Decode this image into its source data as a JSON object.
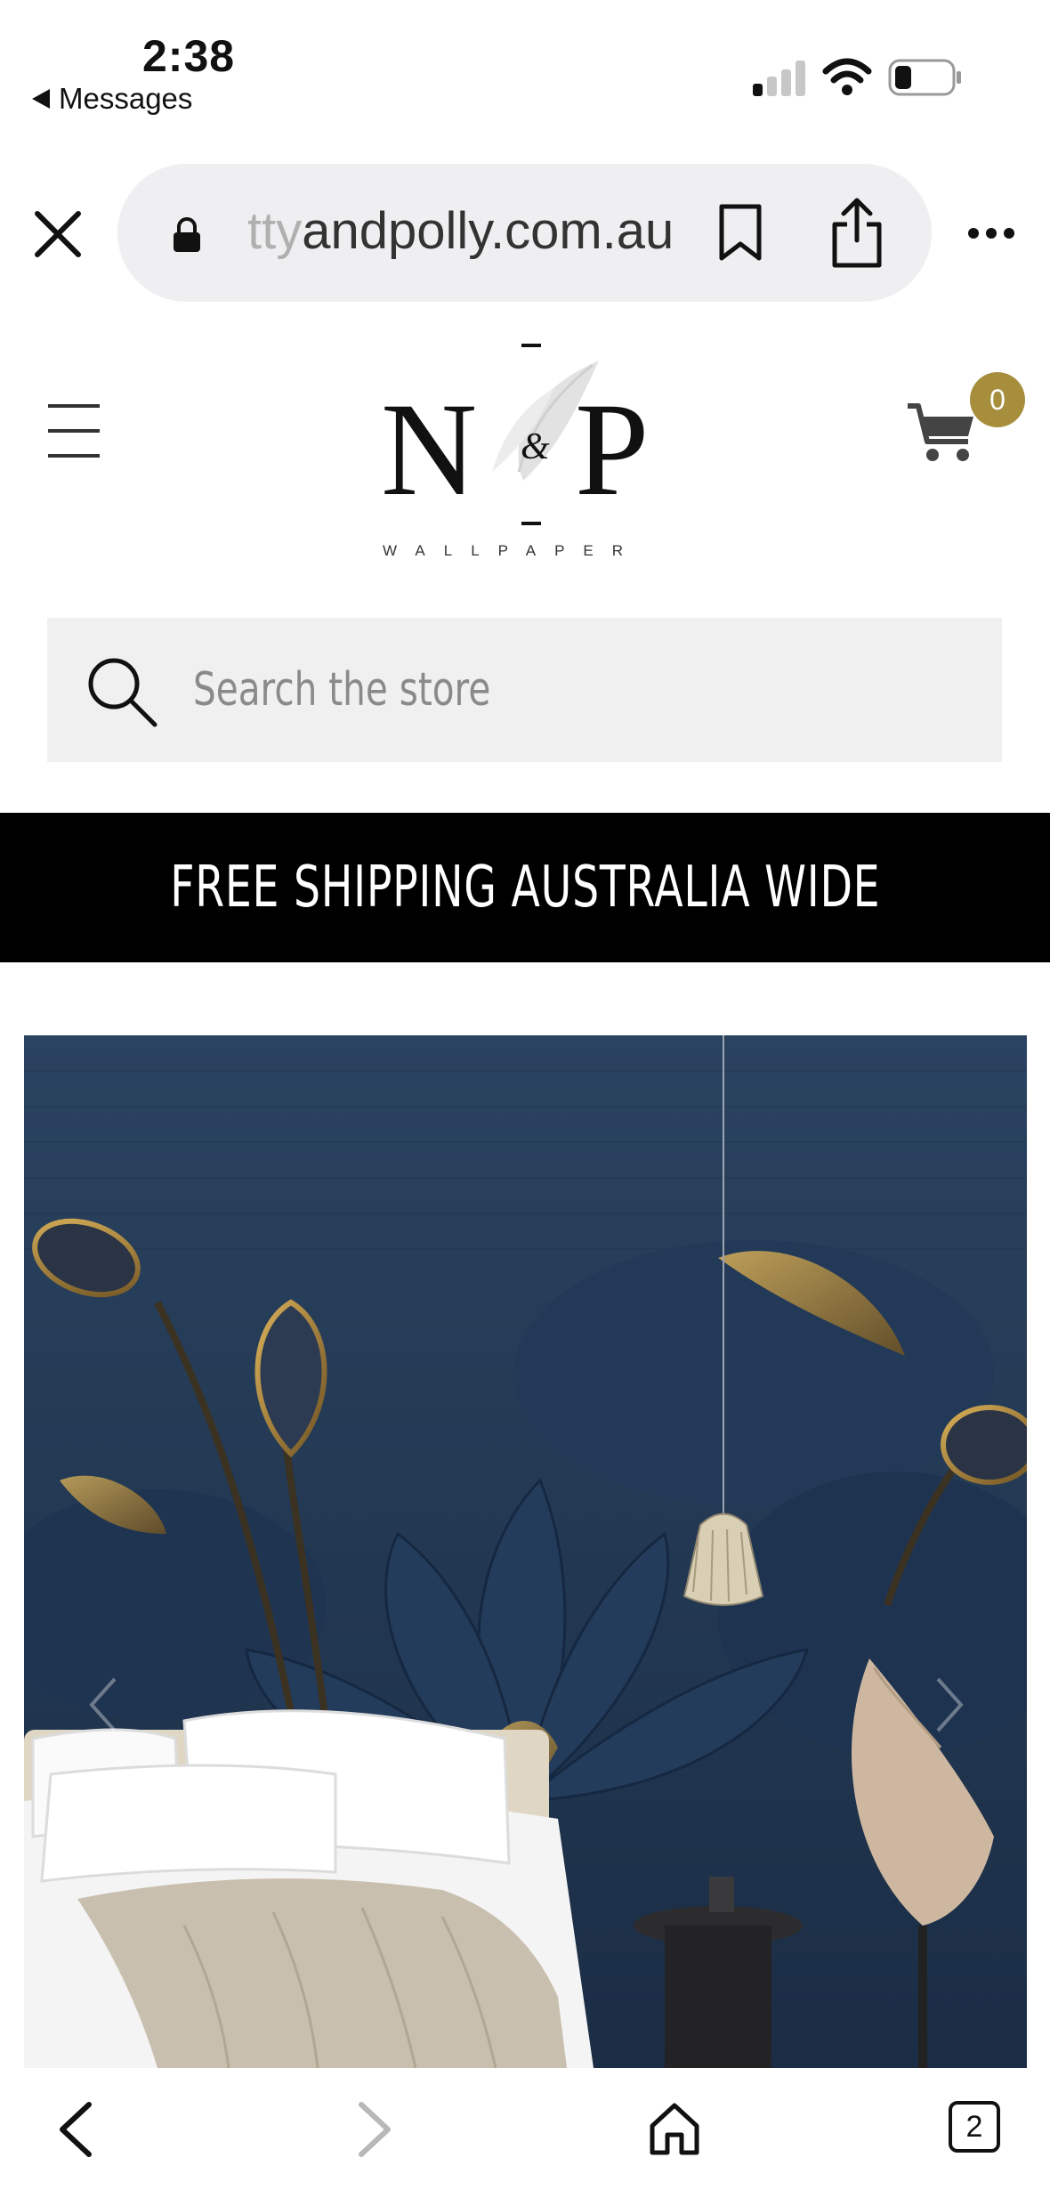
{
  "status_bar": {
    "time": "2:38",
    "back_app": "Messages",
    "icons": [
      "signal-icon",
      "wifi-icon",
      "battery-icon"
    ]
  },
  "browser": {
    "url_faded": "tty",
    "url_main": "andpolly.com.au",
    "icons": [
      "close-icon",
      "lock-icon",
      "bookmark-icon",
      "share-icon",
      "more-icon"
    ]
  },
  "store_header": {
    "logo_text": "N & P",
    "logo_sub": "WALLPAPER",
    "cart_count": "0",
    "accent_color": "#a68e3d"
  },
  "search": {
    "placeholder": "Search the store"
  },
  "banner": {
    "text": "FREE SHIPPING AUSTRALIA WIDE"
  },
  "hero": {
    "description_icons": [
      "carousel-prev-icon",
      "carousel-next-icon"
    ]
  },
  "toolbar": {
    "tabs_count": "2",
    "icons": [
      "back-icon",
      "forward-icon",
      "home-icon",
      "tabs-icon"
    ]
  }
}
